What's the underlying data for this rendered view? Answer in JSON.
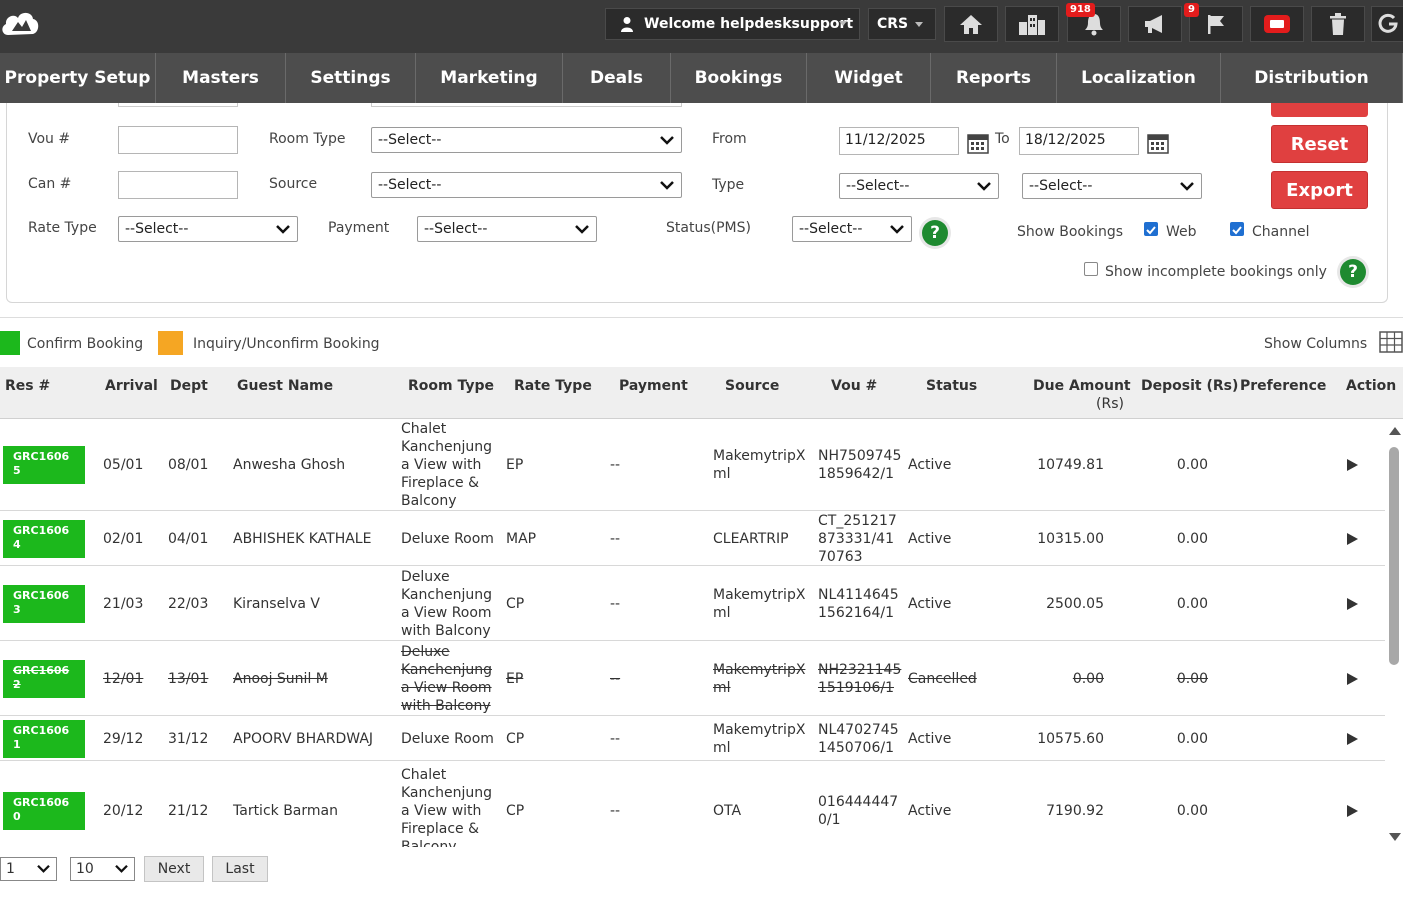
{
  "topbar": {
    "welcome": "Welcome helpdesksupport",
    "crs": "CRS",
    "alerts_badge": "918",
    "flags_badge": "9"
  },
  "nav": [
    {
      "label": "Property Setup",
      "w": 156
    },
    {
      "label": "Masters",
      "w": 130
    },
    {
      "label": "Settings",
      "w": 130
    },
    {
      "label": "Marketing",
      "w": 147
    },
    {
      "label": "Deals",
      "w": 108
    },
    {
      "label": "Bookings",
      "w": 136
    },
    {
      "label": "Widget",
      "w": 124
    },
    {
      "label": "Reports",
      "w": 126
    },
    {
      "label": "Localization",
      "w": 164
    },
    {
      "label": "Distribution",
      "w": 182
    }
  ],
  "filters": {
    "vou_label": "Vou #",
    "can_label": "Can #",
    "rate_type_label": "Rate Type",
    "rate_type_value": "--Select--",
    "room_type_label": "Room Type",
    "room_type_value": "--Select--",
    "source_label": "Source",
    "source_value": "--Select--",
    "payment_label": "Payment",
    "payment_value": "--Select--",
    "from_label": "From",
    "from_value": "11/12/2025",
    "to_label": "To",
    "to_value": "18/12/2025",
    "type_label": "Type",
    "type_value_1": "--Select--",
    "type_value_2": "--Select--",
    "status_pms_label": "Status(PMS)",
    "status_pms_value": "--Select--",
    "show_bookings_label": "Show Bookings",
    "web_label": "Web",
    "channel_label": "Channel",
    "incomplete_label": "Show incomplete bookings only",
    "reset_label": "Reset",
    "export_label": "Export"
  },
  "legend": {
    "confirm_label": "Confirm Booking",
    "inquiry_label": "Inquiry/Unconfirm Booking",
    "show_columns_label": "Show Columns",
    "confirm_color": "#1cb81c",
    "inquiry_color": "#f5a623"
  },
  "columns": {
    "res": "Res #",
    "arrival": "Arrival",
    "dept": "Dept",
    "guest": "Guest Name",
    "room_type": "Room Type",
    "rate_type": "Rate Type",
    "payment": "Payment",
    "source": "Source",
    "vou": "Vou #",
    "status": "Status",
    "due_1": "Due Amount",
    "due_2": "(Rs)",
    "deposit": "Deposit (Rs)",
    "preference": "Preference",
    "action": "Action"
  },
  "rows": [
    {
      "res_1": "GRC1606",
      "res_2": "5",
      "arrival": "05/01",
      "dept": "08/01",
      "guest": "Anwesha Ghosh",
      "room_type": [
        "Chalet",
        "Kanchenjung",
        "a View with",
        "Fireplace &",
        "Balcony"
      ],
      "rate": "EP",
      "payment": "--",
      "source": [
        "MakemytripX",
        "ml"
      ],
      "vou": [
        "NH7509745",
        "1859642/1"
      ],
      "status": "Active",
      "due": "10749.81",
      "deposit": "0.00"
    },
    {
      "res_1": "GRC1606",
      "res_2": "4",
      "arrival": "02/01",
      "dept": "04/01",
      "guest": "ABHISHEK KATHALE",
      "room_type": [
        "Deluxe Room"
      ],
      "rate": "MAP",
      "payment": "--",
      "source": [
        "CLEARTRIP"
      ],
      "vou": [
        "CT_251217",
        "873331/41",
        "70763"
      ],
      "status": "Active",
      "due": "10315.00",
      "deposit": "0.00"
    },
    {
      "res_1": "GRC1606",
      "res_2": "3",
      "arrival": "21/03",
      "dept": "22/03",
      "guest": "Kiranselva V",
      "room_type": [
        "Deluxe",
        "Kanchenjung",
        "a View Room",
        "with Balcony"
      ],
      "rate": "CP",
      "payment": "--",
      "source": [
        "MakemytripX",
        "ml"
      ],
      "vou": [
        "NL4114645",
        "1562164/1"
      ],
      "status": "Active",
      "due": "2500.05",
      "deposit": "0.00"
    },
    {
      "res_1": "GRC1606",
      "res_2": "2",
      "arrival": "12/01",
      "dept": "13/01",
      "guest": "Anooj Sunil M",
      "room_type": [
        "Deluxe",
        "Kanchenjung",
        "a View Room",
        "with Balcony"
      ],
      "rate": "EP",
      "payment": "--",
      "source": [
        "MakemytripX",
        "ml"
      ],
      "vou": [
        "NH2321145",
        "1519106/1"
      ],
      "status": "Cancelled",
      "due": "0.00",
      "deposit": "0.00"
    },
    {
      "res_1": "GRC1606",
      "res_2": "1",
      "arrival": "29/12",
      "dept": "31/12",
      "guest": "APOORV BHARDWAJ",
      "room_type": [
        "Deluxe Room"
      ],
      "rate": "CP",
      "payment": "--",
      "source": [
        "MakemytripX",
        "ml"
      ],
      "vou": [
        "NL4702745",
        "1450706/1"
      ],
      "status": "Active",
      "due": "10575.60",
      "deposit": "0.00"
    },
    {
      "res_1": "GRC1606",
      "res_2": "0",
      "arrival": "20/12",
      "dept": "21/12",
      "guest": "Tartick Barman",
      "room_type": [
        "Chalet",
        "Kanchenjung",
        "a View with",
        "Fireplace &",
        "Balcony"
      ],
      "rate": "CP",
      "payment": "--",
      "source": [
        "OTA"
      ],
      "vou": [
        "016444447",
        "0/1"
      ],
      "status": "Active",
      "due": "7190.92",
      "deposit": "0.00"
    }
  ],
  "pager": {
    "page_value": "1",
    "size_value": "10",
    "next_label": "Next",
    "last_label": "Last"
  }
}
